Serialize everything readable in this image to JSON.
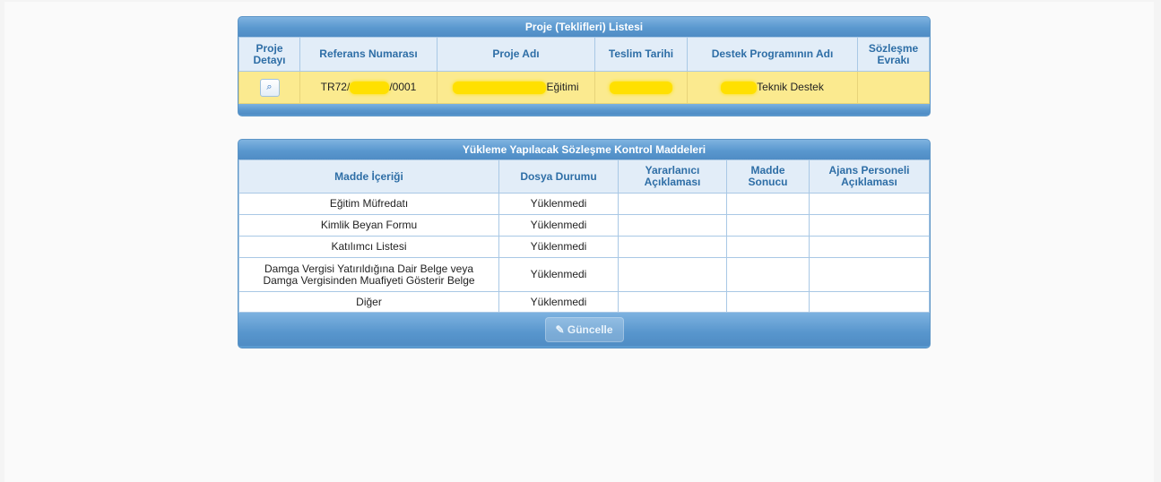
{
  "project_list": {
    "title": "Proje (Teklifleri) Listesi",
    "headers": {
      "detail": "Proje Detayı",
      "reference": "Referans Numarası",
      "project_name": "Proje Adı",
      "delivery_date": "Teslim Tarihi",
      "program_name": "Destek Programının Adı",
      "contract_docs": "Sözleşme Evrakı"
    },
    "row": {
      "detail_icon": "search-icon",
      "reference_prefix": "TR72/",
      "reference_suffix": "/0001",
      "project_name_suffix": "Eğitimi",
      "program_name_suffix": "Teknik Destek",
      "contract_docs": ""
    },
    "highlight_color": "#fbea8f",
    "redaction_color": "#ffe000"
  },
  "checklist": {
    "title": "Yükleme Yapılacak Sözleşme Kontrol Maddeleri",
    "headers": {
      "item": "Madde İçeriği",
      "file_status": "Dosya Durumu",
      "beneficiary_note": "Yararlanıcı Açıklaması",
      "item_result": "Madde Sonucu",
      "agency_note": "Ajans Personeli Açıklaması"
    },
    "rows": [
      {
        "item": "Eğitim Müfredatı",
        "status": "Yüklenmedi"
      },
      {
        "item": "Kimlik Beyan Formu",
        "status": "Yüklenmedi"
      },
      {
        "item": "Katılımcı Listesi",
        "status": "Yüklenmedi"
      },
      {
        "item_line1": "Damga Vergisi Yatırıldığına Dair Belge veya",
        "item_line2": "Damga Vergisinden Muafiyeti Gösterir Belge",
        "status": "Yüklenmedi"
      },
      {
        "item": "Diğer",
        "status": "Yüklenmedi"
      }
    ],
    "update_button": "Güncelle",
    "update_icon": "pencil-icon"
  }
}
